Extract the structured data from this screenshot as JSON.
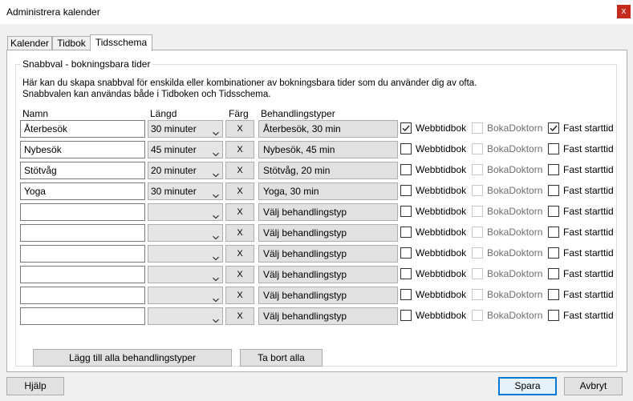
{
  "window": {
    "title": "Administrera kalender",
    "close_label": "x"
  },
  "tabs": [
    {
      "label": "Kalender",
      "active": false
    },
    {
      "label": "Tidbok",
      "active": false
    },
    {
      "label": "Tidsschema",
      "active": true
    }
  ],
  "group": {
    "title": "Snabbval - bokningsbara tider",
    "desc_line1": "Här kan du skapa snabbval för enskilda eller kombinationer av bokningsbara tider som du använder dig av ofta.",
    "desc_line2": "Snabbvalen kan användas både i Tidboken och Tidsschema."
  },
  "columns": {
    "name": "Namn",
    "length": "Längd",
    "color": "Färg",
    "treatments": "Behandlingstyper"
  },
  "checkbox_labels": {
    "web": "Webbtidbok",
    "boka": "BokaDoktorn",
    "fixed": "Fast starttid"
  },
  "color_button_label": "X",
  "rows": [
    {
      "name": "Återbesök",
      "length": "30 minuter",
      "treatment": "Återbesök, 30 min",
      "web": true,
      "boka": false,
      "fixed": true
    },
    {
      "name": "Nybesök",
      "length": "45 minuter",
      "treatment": "Nybesök, 45 min",
      "web": false,
      "boka": false,
      "fixed": false
    },
    {
      "name": "Stötvåg",
      "length": "20 minuter",
      "treatment": "Stötvåg, 20 min",
      "web": false,
      "boka": false,
      "fixed": false
    },
    {
      "name": "Yoga",
      "length": "30 minuter",
      "treatment": "Yoga, 30 min",
      "web": false,
      "boka": false,
      "fixed": false
    },
    {
      "name": "",
      "length": "",
      "treatment": "Välj behandlingstyp",
      "web": false,
      "boka": false,
      "fixed": false
    },
    {
      "name": "",
      "length": "",
      "treatment": "Välj behandlingstyp",
      "web": false,
      "boka": false,
      "fixed": false
    },
    {
      "name": "",
      "length": "",
      "treatment": "Välj behandlingstyp",
      "web": false,
      "boka": false,
      "fixed": false
    },
    {
      "name": "",
      "length": "",
      "treatment": "Välj behandlingstyp",
      "web": false,
      "boka": false,
      "fixed": false
    },
    {
      "name": "",
      "length": "",
      "treatment": "Välj behandlingstyp",
      "web": false,
      "boka": false,
      "fixed": false
    },
    {
      "name": "",
      "length": "",
      "treatment": "Välj behandlingstyp",
      "web": false,
      "boka": false,
      "fixed": false
    }
  ],
  "actions": {
    "add_all": "Lägg till alla behandlingstyper",
    "remove_all": "Ta bort alla"
  },
  "footer": {
    "help": "Hjälp",
    "save": "Spara",
    "cancel": "Avbryt"
  },
  "icons": {
    "close": "close-icon",
    "dropdown": "chevron-down-icon",
    "check": "checkmark-icon"
  },
  "colors": {
    "close_bg": "#c42b1c",
    "accent": "#0078d7"
  }
}
